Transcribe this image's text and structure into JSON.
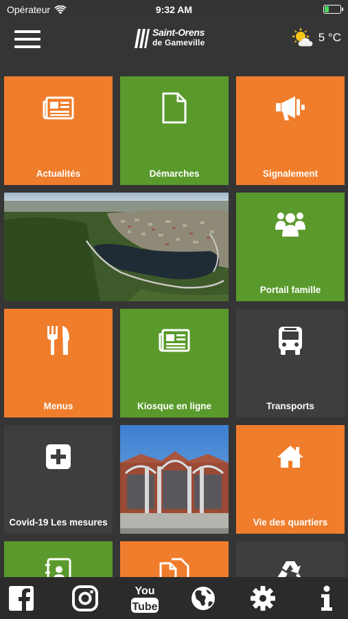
{
  "status_bar": {
    "carrier": "Opérateur",
    "time": "9:32 AM"
  },
  "header": {
    "logo_line1": "Saint-Orens",
    "logo_line2": "de Gameville",
    "temperature": "5 °C",
    "weather_icon": "sun-cloud-icon"
  },
  "tiles": [
    {
      "label": "Actualités",
      "icon": "newspaper-icon",
      "color": "#f07d2b"
    },
    {
      "label": "Démarches",
      "icon": "document-icon",
      "color": "#5a9a2c"
    },
    {
      "label": "Signalement",
      "icon": "megaphone-icon",
      "color": "#f07d2b"
    },
    {
      "label": "Portail famille",
      "icon": "family-icon",
      "color": "#5a9a2c"
    },
    {
      "label": "Menus",
      "icon": "fork-knife-icon",
      "color": "#f07d2b"
    },
    {
      "label": "Kiosque en ligne",
      "icon": "newspaper-icon",
      "color": "#5a9a2c"
    },
    {
      "label": "Transports",
      "icon": "bus-icon",
      "color": "#3e3e3e"
    },
    {
      "label": "Covid-19 Les mesures",
      "icon": "plus-box-icon",
      "color": "#3e3e3e"
    },
    {
      "label": "Vie des quartiers",
      "icon": "house-icon",
      "color": "#f07d2b"
    },
    {
      "label": "",
      "icon": "contact-book-icon",
      "color": "#5a9a2c"
    },
    {
      "label": "",
      "icon": "documents-icon",
      "color": "#f07d2b"
    },
    {
      "label": "",
      "icon": "recycle-icon",
      "color": "#3e3e3e"
    }
  ],
  "photos": [
    {
      "name": "aerial-town-photo"
    },
    {
      "name": "building-facade-photo"
    }
  ],
  "bottom_bar": [
    {
      "icon": "facebook-icon"
    },
    {
      "icon": "instagram-icon"
    },
    {
      "icon": "youtube-icon",
      "line1": "You",
      "line2": "Tube"
    },
    {
      "icon": "globe-icon"
    },
    {
      "icon": "gear-icon"
    },
    {
      "icon": "info-icon"
    }
  ],
  "colors": {
    "orange": "#f07d2b",
    "green": "#5a9a2c",
    "dark": "#3e3e3e",
    "background": "#353535"
  }
}
